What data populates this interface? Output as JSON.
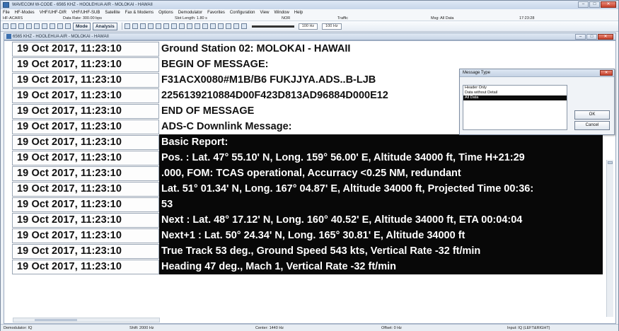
{
  "window": {
    "title": "WAVECOM W-CODE - 6565 KHZ - HOOLEHUA AIR - MOLOKAI - HAWAII",
    "min_label": "–",
    "max_label": "□",
    "close_label": "✕"
  },
  "menu": [
    "File",
    "HF-Modes",
    "VHF/UHF-DIR",
    "VHF/UHF-SUB",
    "Satellite",
    "Fax & Modems",
    "Options",
    "Demodulator",
    "Favorites",
    "Configuration",
    "View",
    "Window",
    "Help"
  ],
  "infobar": {
    "mode": "HF-ACARS",
    "data_rate": "Data Rate: 300.00 bps",
    "slot_length": "Slot Length: 1.80 s",
    "nor": "NOR",
    "traffic": "Traffic",
    "msg_filter": "Msg: All Data",
    "time": "17:23:28"
  },
  "toolbar": {
    "mode_label": "Mode",
    "analysis_label": "Analysis",
    "freq_left": "100 Hz",
    "freq_right": "100 Hz"
  },
  "inner_window": {
    "title": "6565 KHZ - HOOLEHUA AIR - MOLOKAI - HAWAII"
  },
  "rows": [
    {
      "ts": "19 Oct 2017, 11:23:10",
      "msg": "Ground Station 02: MOLOKAI - HAWAII",
      "style": "light"
    },
    {
      "ts": "19 Oct 2017, 11:23:10",
      "msg": "BEGIN OF MESSAGE:",
      "style": "light"
    },
    {
      "ts": "19 Oct 2017, 11:23:10",
      "msg": "F31ACX0080#M1B/B6 FUKJJYA.ADS..B-LJB",
      "style": "light"
    },
    {
      "ts": "19 Oct 2017, 11:23:10",
      "msg": "2256139210884D00F423D813AD96884D000E12",
      "style": "light"
    },
    {
      "ts": "19 Oct 2017, 11:23:10",
      "msg": "END OF MESSAGE",
      "style": "light"
    },
    {
      "ts": "19 Oct 2017, 11:23:10",
      "msg": "ADS-C Downlink Message:",
      "style": "light"
    },
    {
      "ts": "19 Oct 2017, 11:23:10",
      "msg": "Basic Report:",
      "style": "dark"
    },
    {
      "ts": "19 Oct 2017, 11:23:10",
      "msg": "Pos.   : Lat. 47° 55.10' N, Long. 159° 56.00' E, Altitude 34000 ft, Time H+21:29",
      "style": "dark"
    },
    {
      "ts": "19 Oct 2017, 11:23:10",
      "msg": ".000, FOM: TCAS operational, Accurracy <0.25 NM, redundant",
      "style": "dark"
    },
    {
      "ts": "19 Oct 2017, 11:23:10",
      "msg": "Lat. 51° 01.34' N, Long. 167° 04.87' E, Altitude 34000 ft, Projected Time 00:36:",
      "style": "dark"
    },
    {
      "ts": "19 Oct 2017, 11:23:10",
      "msg": "53",
      "style": "dark"
    },
    {
      "ts": "19 Oct 2017, 11:23:10",
      "msg": "Next   : Lat. 48° 17.12' N, Long. 160° 40.52' E, Altitude 34000 ft, ETA 00:04:04",
      "style": "dark"
    },
    {
      "ts": "19 Oct 2017, 11:23:10",
      "msg": "Next+1 : Lat. 50° 24.34' N, Long. 165° 30.81' E, Altitude 34000 ft",
      "style": "dark"
    },
    {
      "ts": "19 Oct 2017, 11:23:10",
      "msg": "True Track 53 deg., Ground Speed 543 kts, Vertical Rate -32 ft/min",
      "style": "dark"
    },
    {
      "ts": "19 Oct 2017, 11:23:10",
      "msg": "Heading 47 deg., Mach 1, Vertical Rate -32 ft/min",
      "style": "dark"
    }
  ],
  "dialog": {
    "title": "Message Type",
    "options": [
      "Header Only",
      "Data without Detail",
      "All Data"
    ],
    "selected_index": 2,
    "ok_label": "OK",
    "cancel_label": "Cancel"
  },
  "status": {
    "demodulator": "Demodulator: IQ",
    "shift": "Shift: 2000 Hz",
    "center": "Center: 1440 Hz",
    "offset": "Offset: 0 Hz",
    "input": "Input: IQ (LEFT&RIGHT)"
  }
}
